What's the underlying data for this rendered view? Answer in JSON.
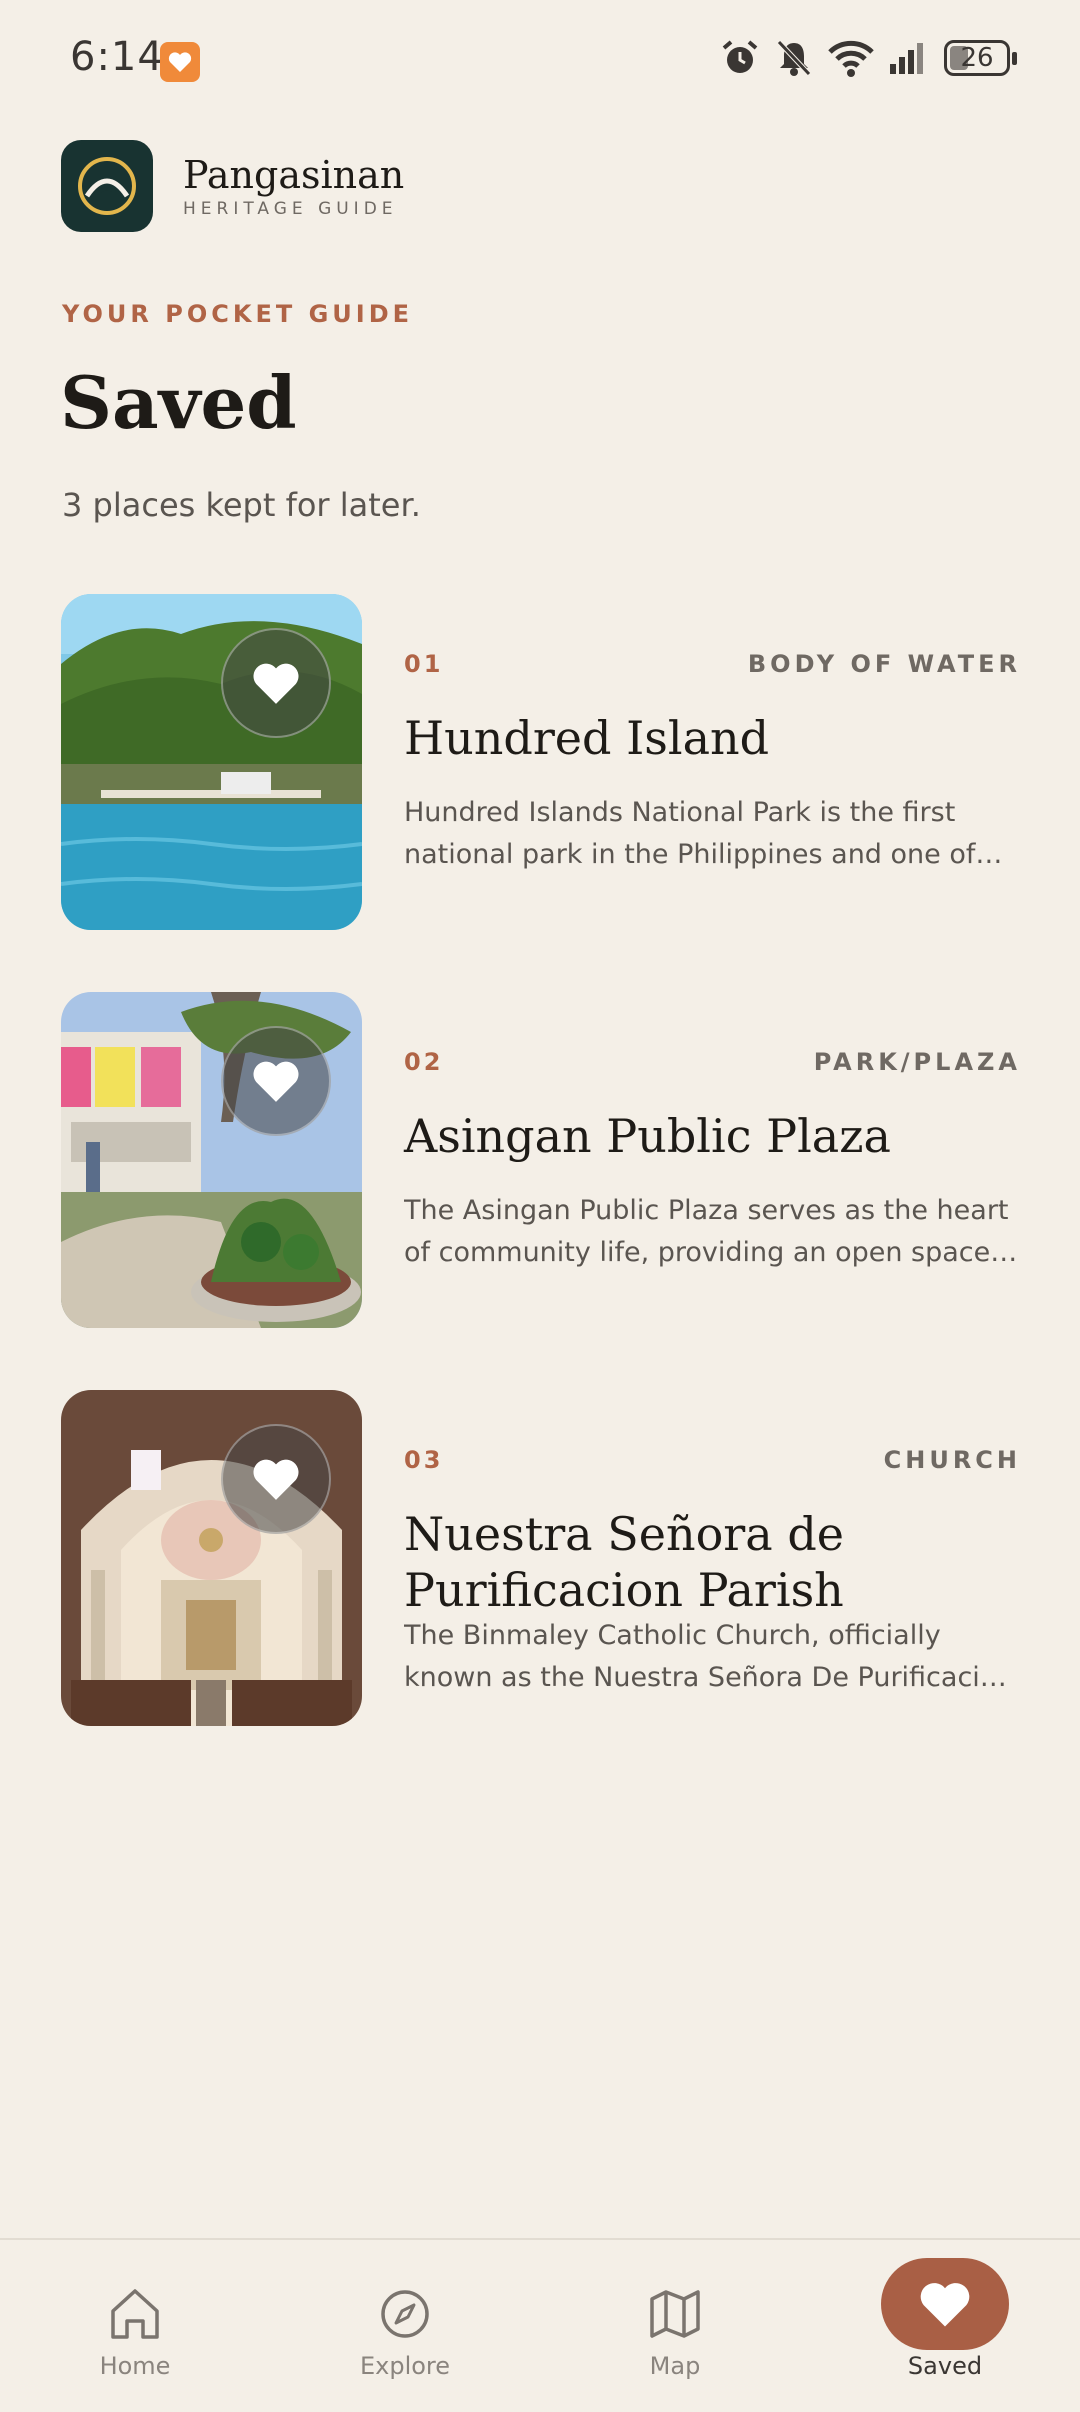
{
  "status_bar": {
    "time": "6:14",
    "battery": "26",
    "icons": [
      "app-notification-icon",
      "alarm-icon",
      "mute-icon",
      "wifi-icon",
      "signal-icon",
      "battery-icon"
    ]
  },
  "brand": {
    "name": "Pangasinan",
    "subtitle": "HERITAGE GUIDE"
  },
  "header": {
    "kicker": "YOUR POCKET GUIDE",
    "title": "Saved",
    "subtitle": "3 places kept for later."
  },
  "places": [
    {
      "number": "01",
      "category": "BODY OF WATER",
      "name": "Hundred Island",
      "description": "Hundred Islands National Park is the first national park in the Philippines and one of the most visited tourist destinations in Pangasinan."
    },
    {
      "number": "02",
      "category": "PARK/PLAZA",
      "name": "Asingan Public Plaza",
      "description": "The Asingan Public Plaza serves as the heart of community life, providing an open space for gatherings and events."
    },
    {
      "number": "03",
      "category": "CHURCH",
      "name": "Nuestra Señora de Purificacion Parish",
      "description": "The Binmaley Catholic Church, officially known as the Nuestra Señora De Purificacion was founded by the Augustinians."
    }
  ],
  "nav": {
    "home": "Home",
    "explore": "Explore",
    "map": "Map",
    "saved": "Saved"
  },
  "colors": {
    "background": "#F4EFE7",
    "accent": "#A95F45",
    "kicker": "#B06446",
    "logo_bg": "#183331"
  }
}
